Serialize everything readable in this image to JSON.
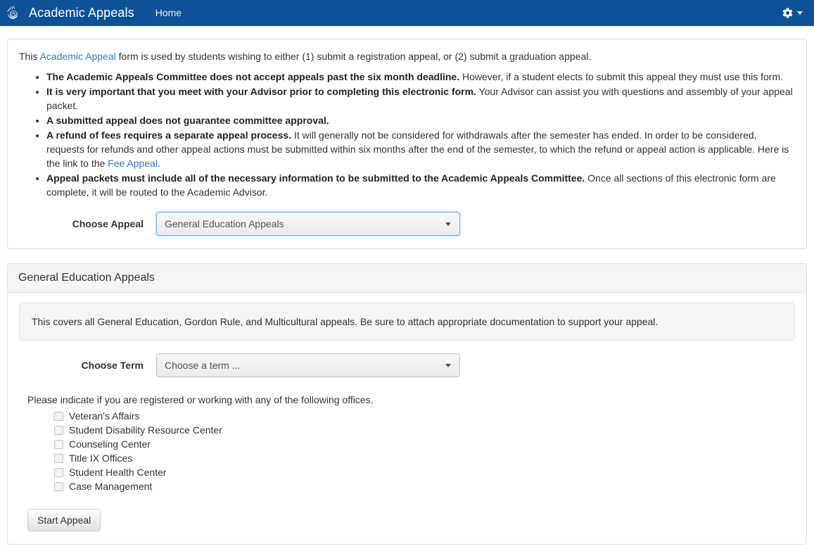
{
  "navbar": {
    "brand": "Academic Appeals",
    "brand_logo_icon": "nautilus-shell-icon",
    "home_link": "Home",
    "settings_icon": "gear-icon",
    "settings_caret_icon": "caret-down-icon",
    "background_color": "#0d5296"
  },
  "intro": {
    "before_link": "This ",
    "link_text": "Academic Appeal",
    "after_link": " form is used by students wishing to either (1) submit a registration appeal, or (2) submit a graduation appeal.",
    "link_color": "#337ab7"
  },
  "notes": [
    {
      "bold": "The Academic Appeals Committee does not accept appeals past the six month deadline.",
      "rest": " However, if a student elects to submit this appeal they must use this form."
    },
    {
      "bold": "It is very important that you meet with your Advisor prior to completing this electronic form.",
      "rest": " Your Advisor can assist you with questions and assembly of your appeal packet."
    },
    {
      "bold": "A submitted appeal does not guarantee committee approval.",
      "rest": ""
    },
    {
      "bold": "A refund of fees requires a separate appeal process.",
      "rest": " It will generally not be considered for withdrawals after the semester has ended. In order to be considered, requests for refunds and other appeal actions must be submitted within six months after the end of the semester, to which the refund or appeal action is applicable. Here is the link to the ",
      "link_text": "Fee Appeal",
      "tail": "."
    },
    {
      "bold": "Appeal packets must include all of the necessary information to be submitted to the Academic Appeals Committee.",
      "rest": " Once all sections of this electronic form are complete, it will be routed to the Academic Advisor."
    }
  ],
  "choose_appeal": {
    "label": "Choose Appeal",
    "selected": "General Education Appeals",
    "options": [
      "General Education Appeals"
    ],
    "focused": true
  },
  "appeal_panel": {
    "heading": "General Education Appeals",
    "well_text": "This covers all General Education, Gordon Rule, and Multicultural appeals. Be sure to attach appropriate documentation to support your appeal.",
    "choose_term": {
      "label": "Choose Term",
      "selected": "Choose a term ...",
      "options": [
        "Choose a term ..."
      ],
      "focused": false
    },
    "offices_prompt": "Please indicate if you are registered or working with any of the following offices.",
    "offices": [
      {
        "label": "Veteran's Affairs",
        "checked": false
      },
      {
        "label": "Student Disability Resource Center",
        "checked": false
      },
      {
        "label": "Counseling Center",
        "checked": false
      },
      {
        "label": "Title IX Offices",
        "checked": false
      },
      {
        "label": "Student Health Center",
        "checked": false
      },
      {
        "label": "Case Management",
        "checked": false
      }
    ],
    "start_button": "Start Appeal"
  }
}
